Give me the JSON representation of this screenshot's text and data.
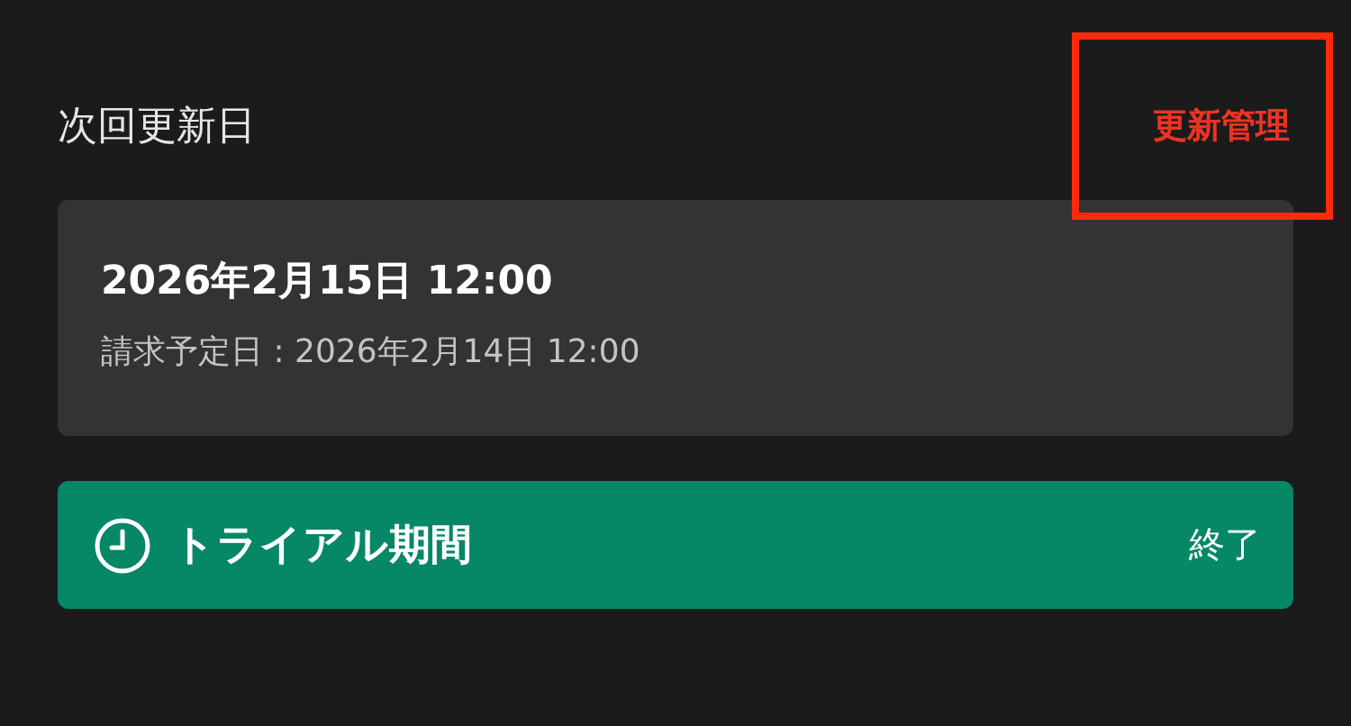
{
  "section_title": "次回更新日",
  "manage_link": {
    "label": "更新管理",
    "highlighted": true
  },
  "renewal_card": {
    "date": "2026年2月15日 12:00",
    "billing": "請求予定日 : 2026年2月14日 12:00"
  },
  "trial_banner": {
    "label": "トライアル期間",
    "status": "終了"
  }
}
